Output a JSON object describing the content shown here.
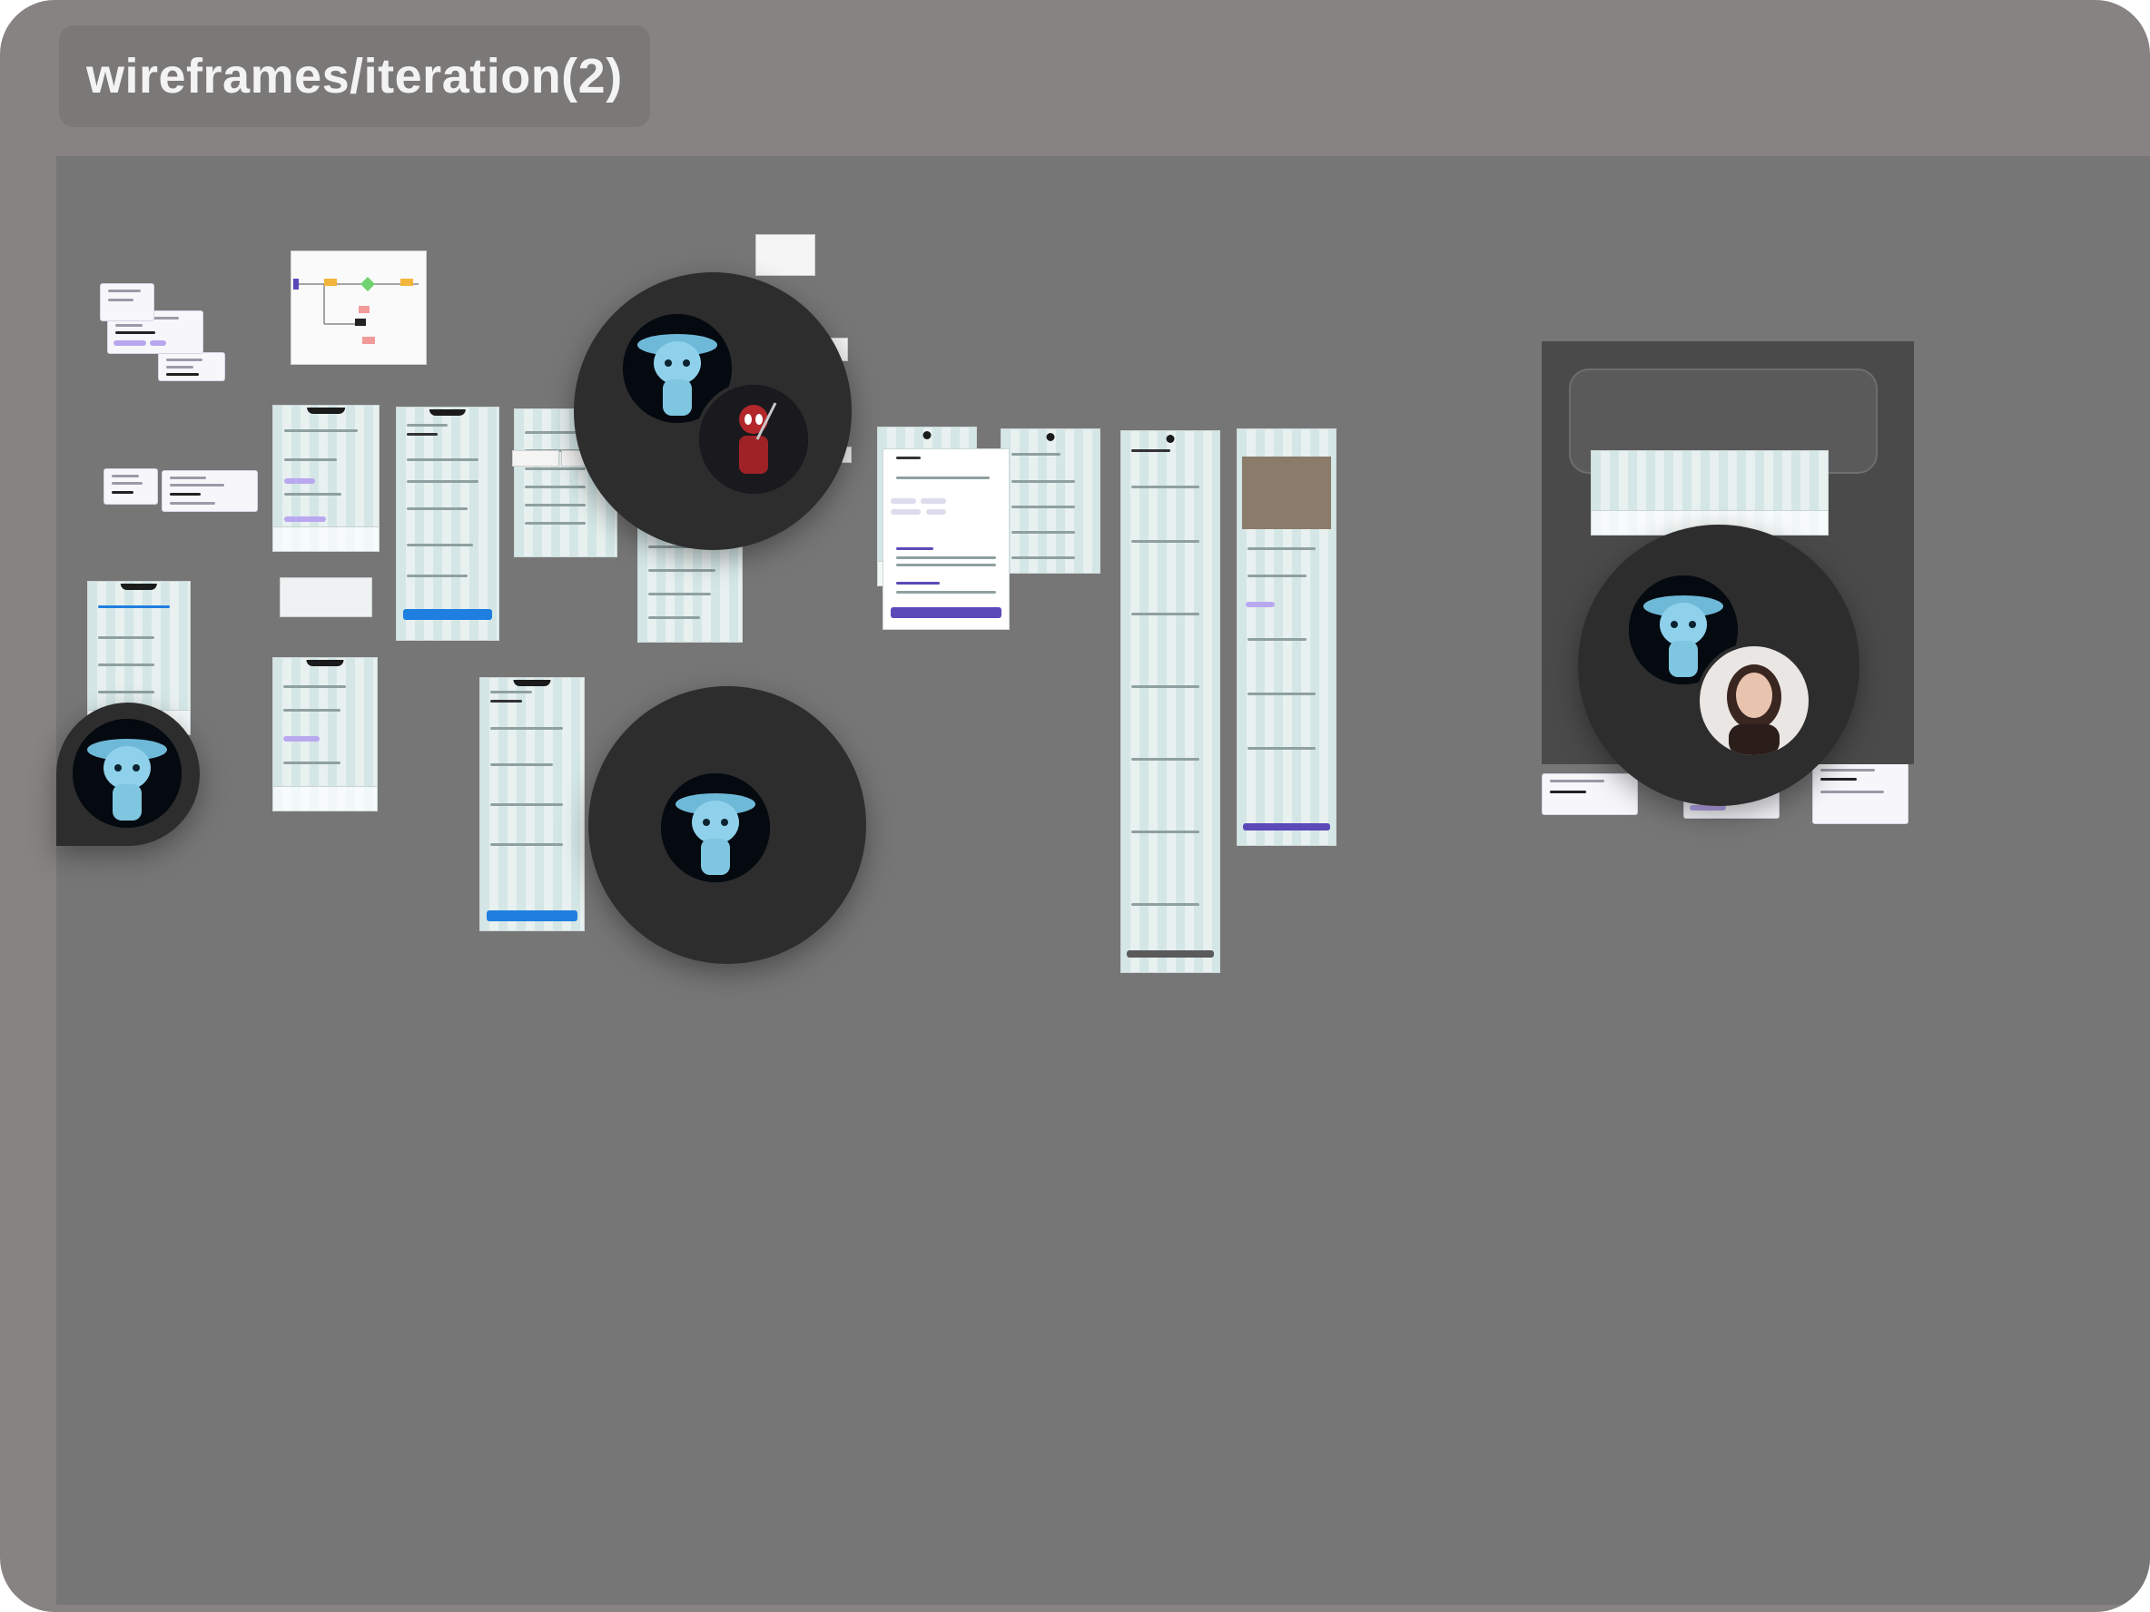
{
  "board": {
    "title": "wireframes/iteration(2)"
  },
  "colors": {
    "window_bg": "#878382",
    "canvas_bg": "#767676",
    "frame_bg": "#e3ecec",
    "primary_button": "#1f7fe0",
    "accent_purple": "#5c49b8",
    "chip_purple": "#b9a8ef",
    "avatar_bubble": "#2d2d2d"
  },
  "collaborators": [
    {
      "name": "ghost-character-avatar"
    },
    {
      "name": "red-hero-avatar"
    },
    {
      "name": "woman-photo-avatar"
    }
  ]
}
